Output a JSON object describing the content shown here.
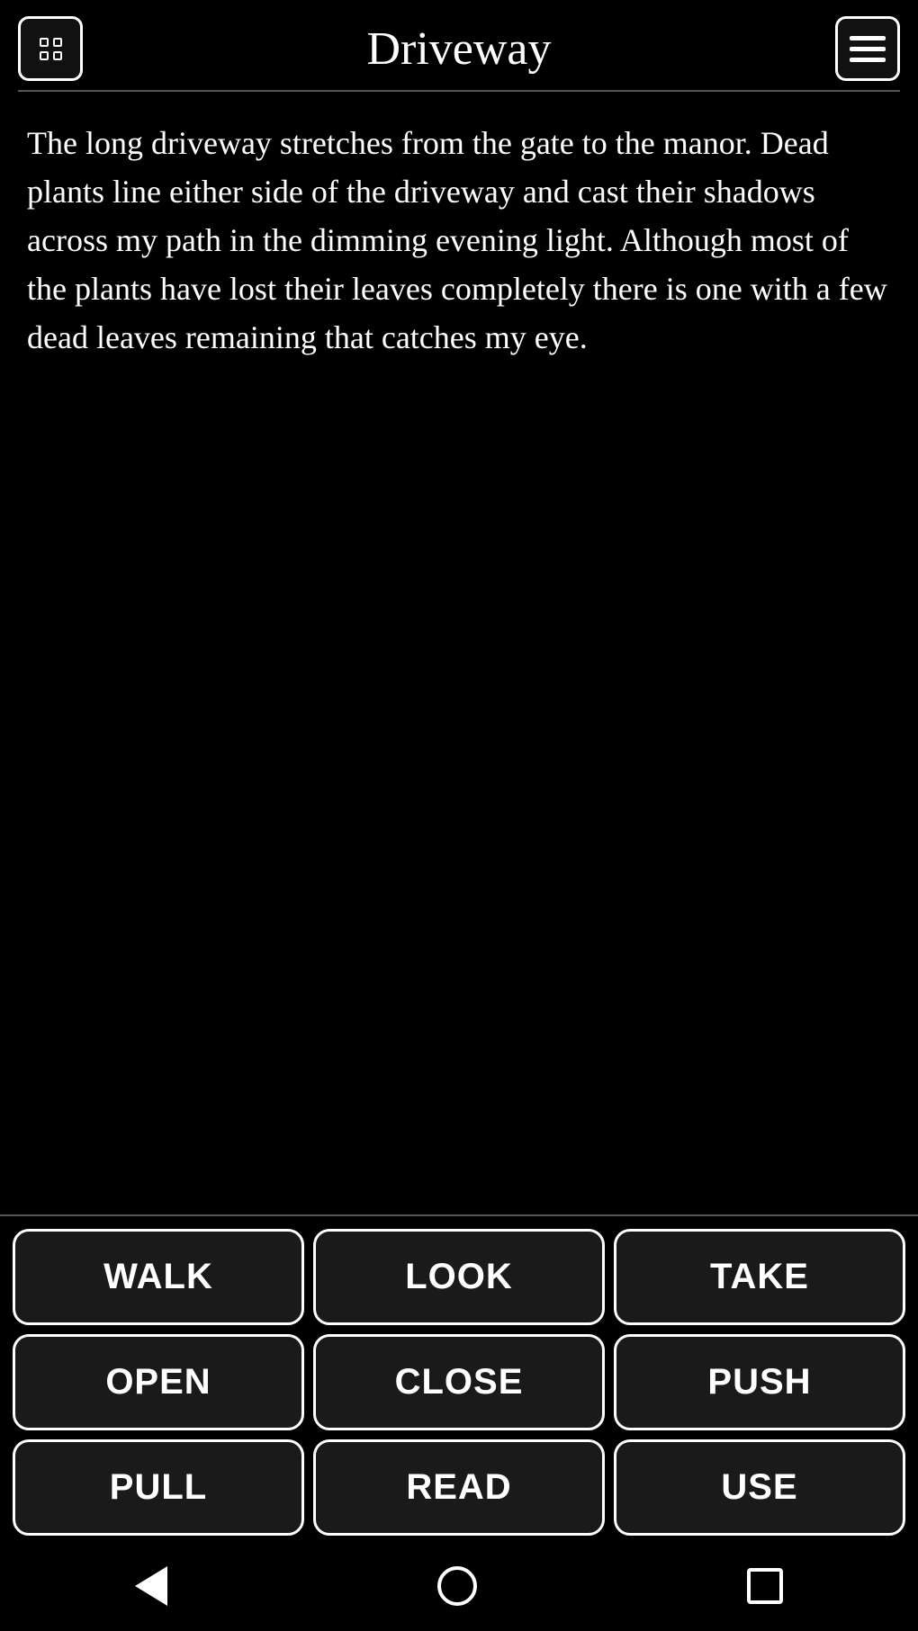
{
  "header": {
    "title": "Driveway",
    "left_icon": "game-icon",
    "right_icon": "menu-icon"
  },
  "scene": {
    "text": "The long driveway stretches from the gate to the manor. Dead plants line either side of the driveway and cast their shadows across my path in the dimming evening light. Although most of the plants have lost their leaves completely there is one with a few dead leaves remaining that catches my eye."
  },
  "actions": [
    {
      "label": "WALK",
      "id": "walk"
    },
    {
      "label": "LOOK",
      "id": "look"
    },
    {
      "label": "TAKE",
      "id": "take"
    },
    {
      "label": "OPEN",
      "id": "open"
    },
    {
      "label": "CLOSE",
      "id": "close"
    },
    {
      "label": "PUSH",
      "id": "push"
    },
    {
      "label": "PULL",
      "id": "pull"
    },
    {
      "label": "READ",
      "id": "read"
    },
    {
      "label": "USE",
      "id": "use"
    }
  ],
  "navbar": {
    "back_label": "back",
    "home_label": "home",
    "recent_label": "recent"
  }
}
